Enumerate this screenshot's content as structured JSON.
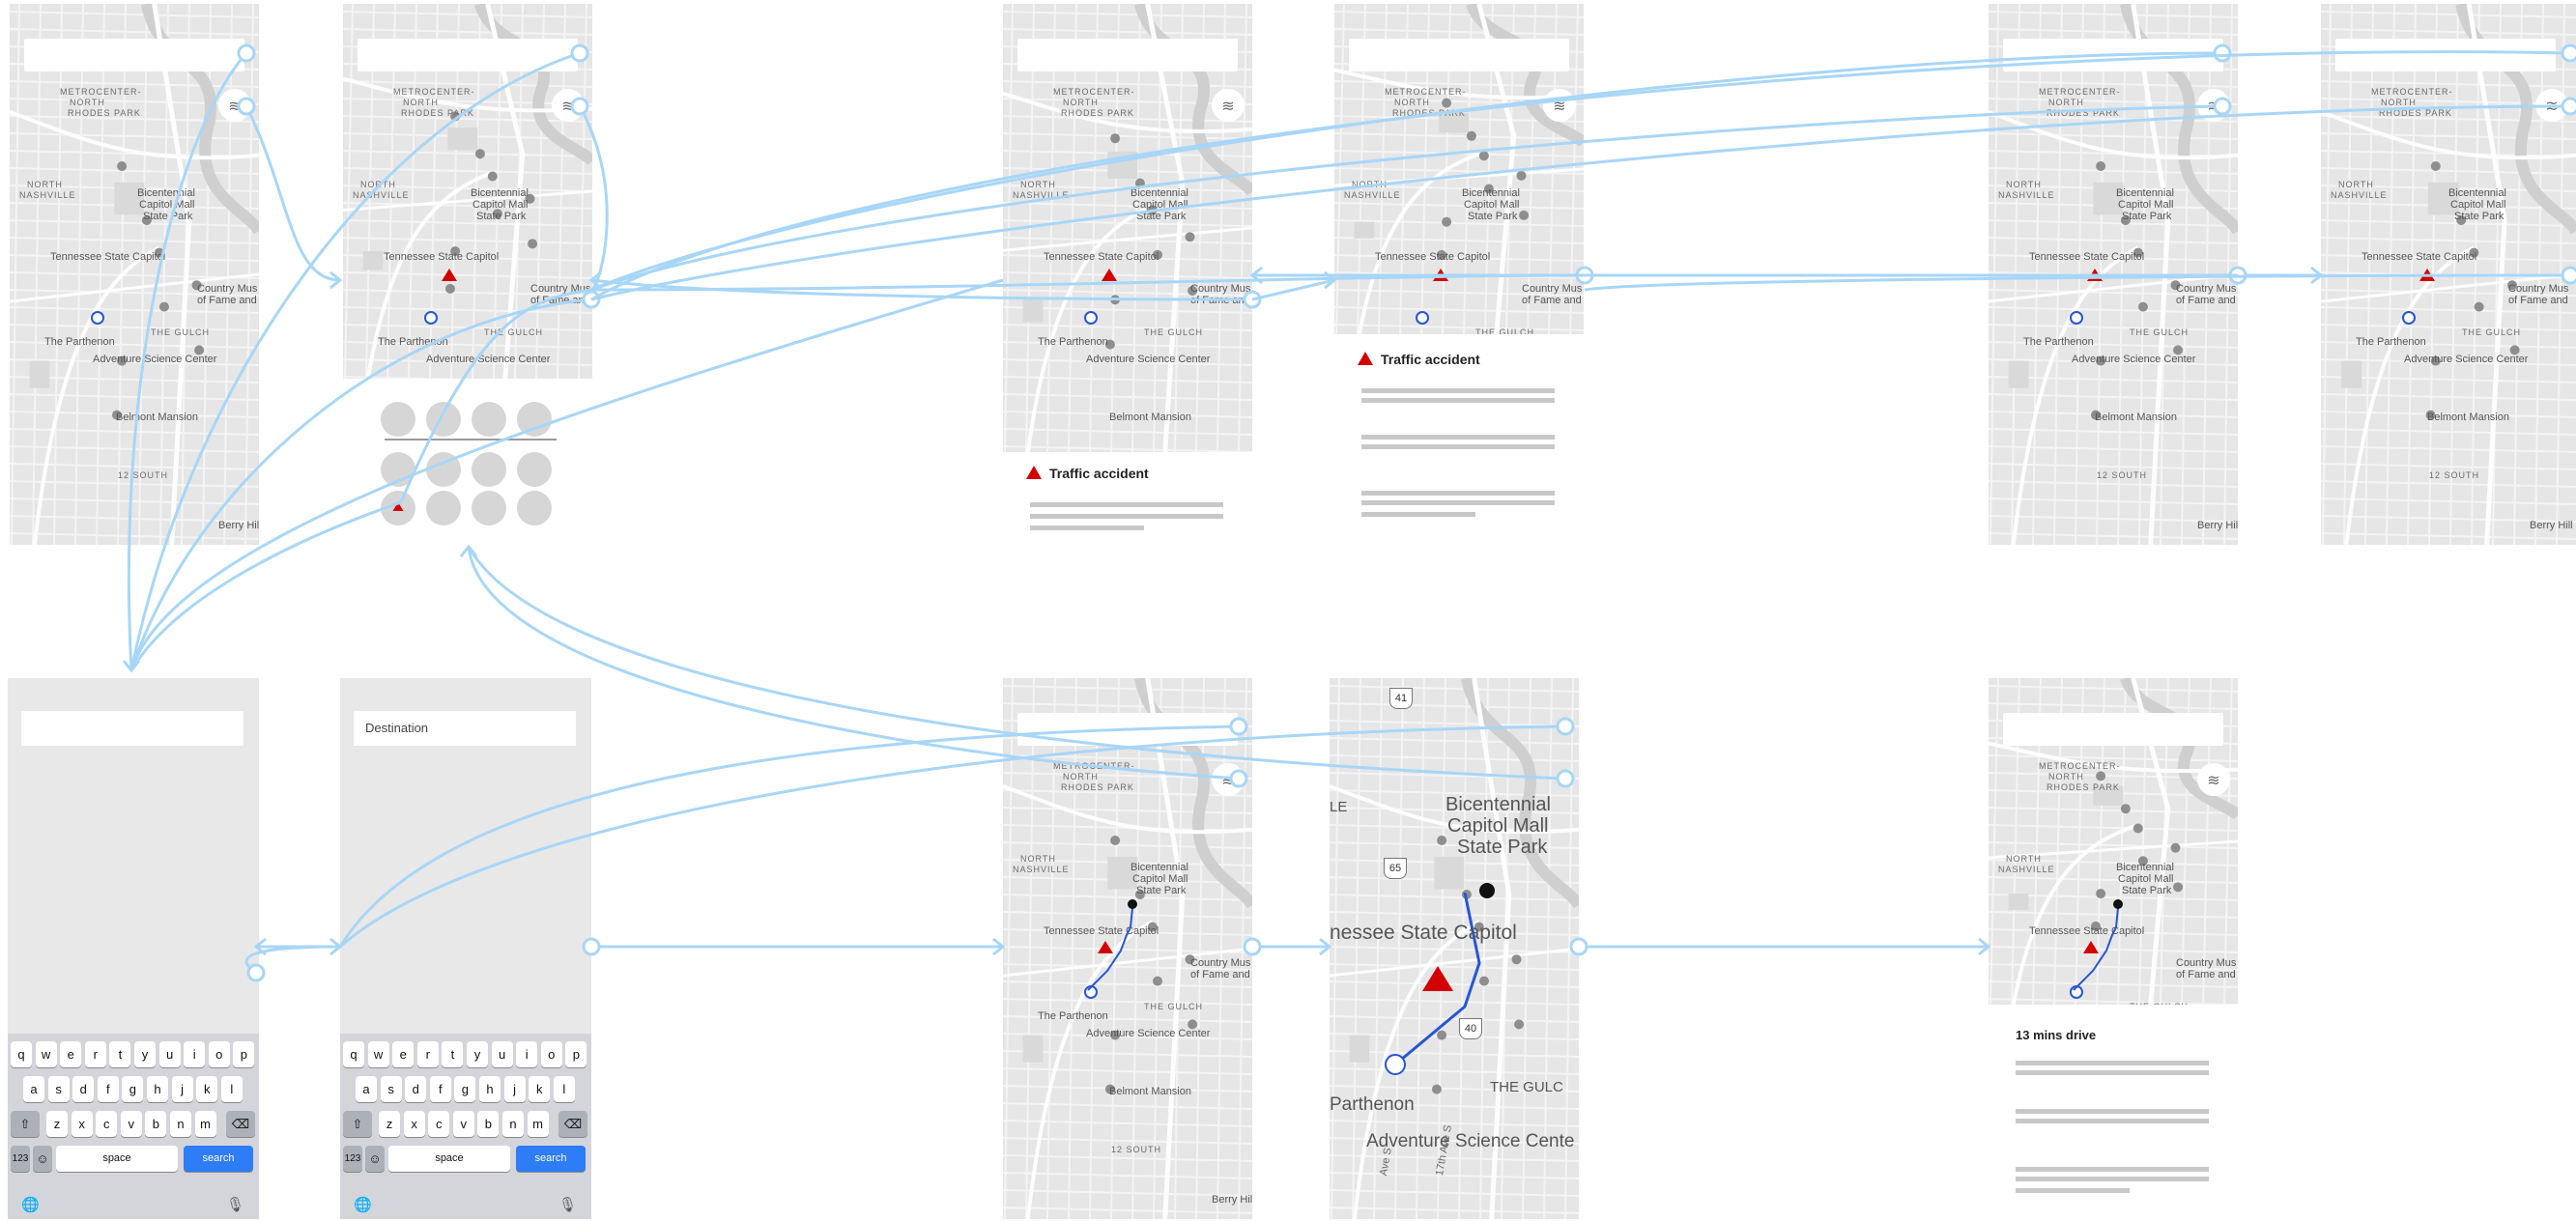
{
  "colors": {
    "accent": "#2e7cf6",
    "connector": "#a8d6f7",
    "incident": "#d40000",
    "route": "#2756d1"
  },
  "map_labels": {
    "metrocenter": "METROCENTER-",
    "north": "NORTH",
    "rhodes": "RHODES PARK",
    "north_nash_1": "NORTH",
    "north_nash_2": "NASHVILLE",
    "bicentennial_1": "Bicentennial",
    "bicentennial_2": "Capitol Mall",
    "bicentennial_3": "State Park",
    "capitol": "Tennessee State Capitol",
    "country_1": "Country Mus",
    "country_2": "of Fame and",
    "parthenon": "The Parthenon",
    "gulch": "THE GULCH",
    "adventure": "Adventure Science Center",
    "belmont": "Belmont Mansion",
    "twelve_south": "12 SOUTH",
    "berry": "Berry Hill"
  },
  "zoom_labels": {
    "bic_1": "Bicentennial",
    "bic_2": "Capitol Mall",
    "bic_3": "State Park",
    "capitol": "nessee State Capitol",
    "parthenon": "Parthenon",
    "adventure": "Adventure Science Cente",
    "gulch": "THE GULC",
    "le": "LE",
    "hwy41": "41",
    "hwy65": "65",
    "hwy40": "40",
    "ave1": "Ave S",
    "ave2": "17th Ave S"
  },
  "incident": {
    "title": "Traffic accident"
  },
  "route": {
    "summary": "13 mins drive"
  },
  "search": {
    "placeholder": "Destination"
  },
  "keyboard": {
    "row1": [
      "q",
      "w",
      "e",
      "r",
      "t",
      "y",
      "u",
      "i",
      "o",
      "p"
    ],
    "row2": [
      "a",
      "s",
      "d",
      "f",
      "g",
      "h",
      "j",
      "k",
      "l"
    ],
    "row3": [
      "z",
      "x",
      "c",
      "v",
      "b",
      "n",
      "m"
    ],
    "num": "123",
    "space": "space",
    "search": "search"
  },
  "icons": [
    "layers-icon",
    "shift-icon",
    "backspace-icon",
    "emoji-icon",
    "globe-icon",
    "microphone-icon",
    "incident-icon",
    "location-dot-icon",
    "destination-pin-icon"
  ]
}
